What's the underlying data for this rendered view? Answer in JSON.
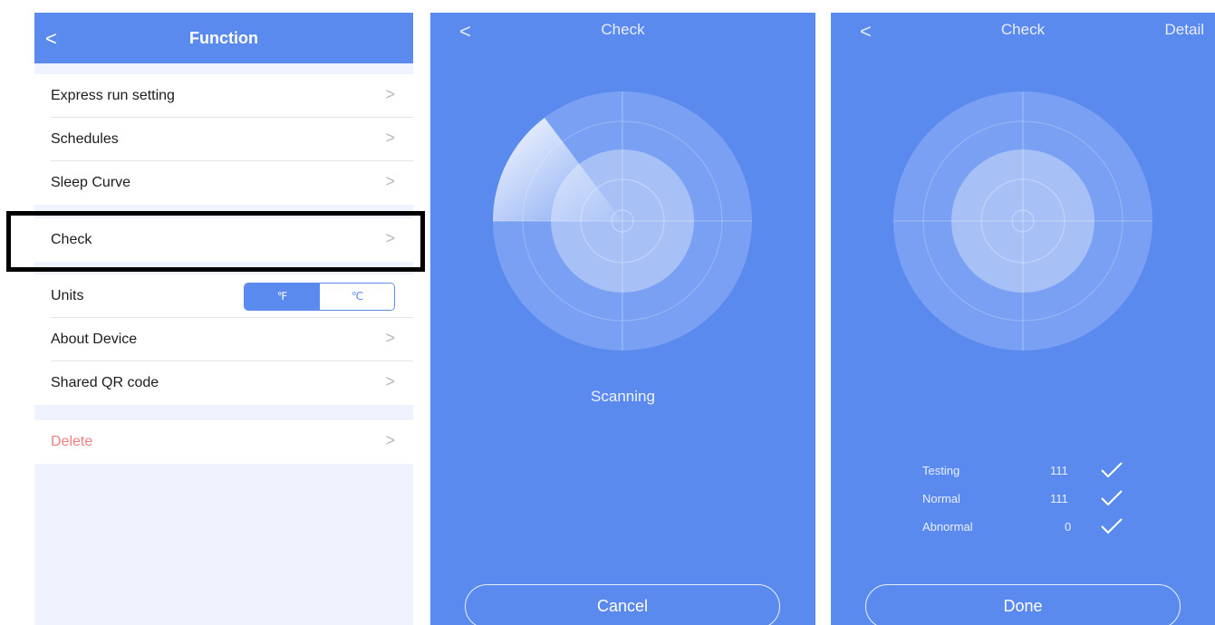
{
  "screen1": {
    "nav": {
      "back_glyph": "<",
      "title": "Function"
    },
    "items": [
      {
        "label": "Express run setting",
        "chev": ">"
      },
      {
        "label": "Schedules",
        "chev": ">"
      },
      {
        "label": "Sleep Curve",
        "chev": ">"
      },
      {
        "label": "Check",
        "chev": ">"
      },
      {
        "label": "Units",
        "options": [
          "℉",
          "℃"
        ],
        "selected": "℉"
      },
      {
        "label": "About Device",
        "chev": ">"
      },
      {
        "label": "Shared QR code",
        "chev": ">"
      },
      {
        "label": "Delete",
        "chev": ">"
      }
    ]
  },
  "screen2": {
    "back_glyph": "<",
    "title": "Check",
    "status": "Scanning",
    "button": "Cancel"
  },
  "screen3": {
    "back_glyph": "<",
    "title": "Check",
    "detail": "Detail",
    "results": [
      {
        "label": "Testing",
        "value": "111",
        "icon": "check-icon"
      },
      {
        "label": "Normal",
        "value": "111",
        "icon": "check-icon"
      },
      {
        "label": "Abnormal",
        "value": "0",
        "icon": "check-icon"
      }
    ],
    "button": "Done"
  },
  "colors": {
    "primary": "#5b8aee",
    "background": "#eef3fd",
    "delete": "#f08080",
    "highlight_border": "#000000"
  }
}
